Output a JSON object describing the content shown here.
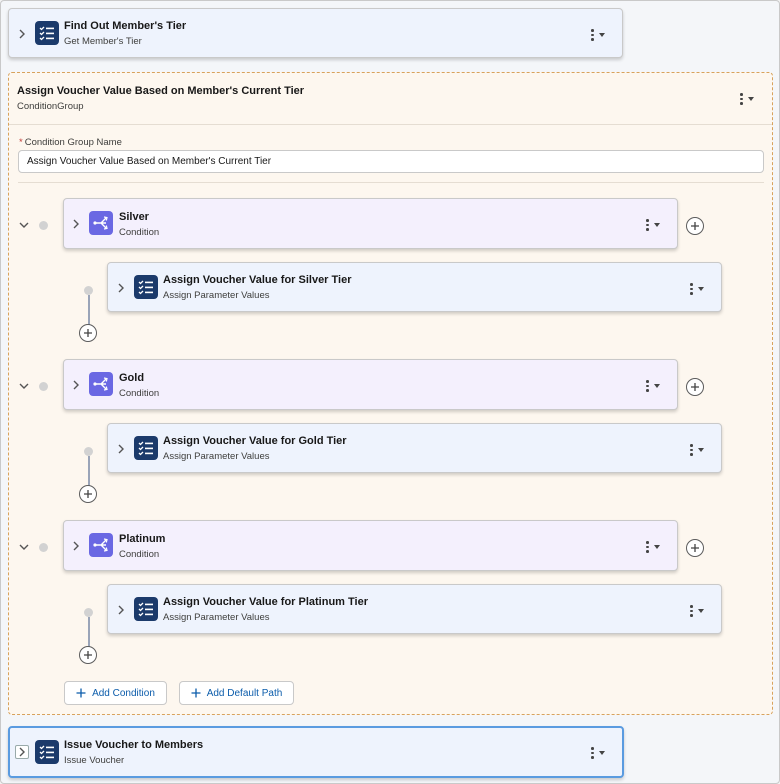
{
  "top_step": {
    "title": "Find Out Member's Tier",
    "subtitle": "Get Member's Tier"
  },
  "group": {
    "title": "Assign Voucher Value Based on Member's Current Tier",
    "type": "ConditionGroup",
    "name_label": "Condition Group Name",
    "required_mark": "*",
    "name_value": "Assign Voucher Value Based on Member's Current Tier",
    "conditions": [
      {
        "title": "Silver",
        "subtitle": "Condition",
        "child_title": "Assign Voucher Value for Silver Tier",
        "child_subtitle": "Assign Parameter Values"
      },
      {
        "title": "Gold",
        "subtitle": "Condition",
        "child_title": "Assign Voucher Value for Gold Tier",
        "child_subtitle": "Assign Parameter Values"
      },
      {
        "title": "Platinum",
        "subtitle": "Condition",
        "child_title": "Assign Voucher Value for Platinum Tier",
        "child_subtitle": "Assign Parameter Values"
      }
    ],
    "add_condition_label": "Add Condition",
    "add_default_path_label": "Add Default Path"
  },
  "bottom_step": {
    "title": "Issue Voucher to Members",
    "subtitle": "Issue Voucher"
  },
  "icons": {
    "expand": "chevron-right-icon",
    "collapse": "chevron-down-icon",
    "step": "checklist-icon",
    "condition": "branch-icon",
    "menu": "vertical-dots-icon",
    "add": "plus-circle-icon"
  },
  "colors": {
    "step_icon_bg": "#1b3a6b",
    "condition_icon_bg": "#6a68e3",
    "link": "#0b5cab",
    "group_border": "#d8a25c"
  }
}
